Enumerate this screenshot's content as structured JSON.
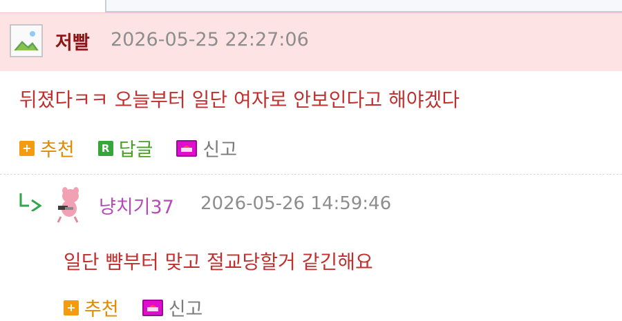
{
  "comment": {
    "author": "저빨",
    "date": "2026-05-25 22:27:06",
    "text": "뒤졌다ㅋㅋ 오늘부터 일단 여자로 안보인다고 해야겠다",
    "actions": {
      "recommend": "추천",
      "reply": "답글",
      "report": "신고"
    }
  },
  "reply": {
    "author": "냥치기37",
    "date": "2026-05-26 14:59:46",
    "text": "일단 뺨부터 맞고 절교당할거 같긴해요",
    "actions": {
      "recommend": "추천",
      "report": "신고"
    }
  },
  "colors": {
    "header_bg": "#fde3e3",
    "author": "#8c1717",
    "text": "#c0302f",
    "recommend": "#f39c12",
    "reply": "#37a43c",
    "report": "#e00dd1",
    "reply_author": "#b64ab8"
  },
  "icons": {
    "avatar_main": "broken-image-icon",
    "reply_arrow": "reply-arrow-icon",
    "reply_avatar": "pig-avatar-icon",
    "recommend": "plus-icon",
    "reply": "r-icon",
    "report": "siren-icon"
  }
}
